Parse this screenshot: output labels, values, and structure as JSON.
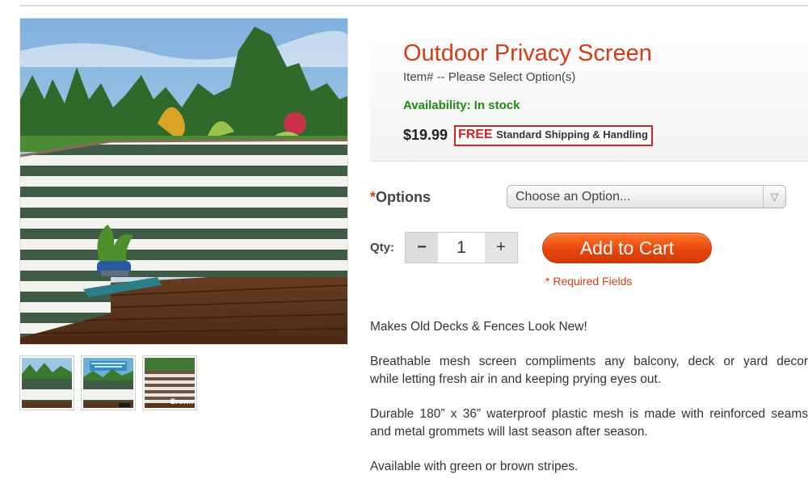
{
  "product": {
    "title": "Outdoor Privacy Screen",
    "item_number": "Item# -- Please Select Option(s)",
    "availability": "Availability: In stock",
    "price": "$19.99",
    "shipping_free": "FREE",
    "shipping_text": "Standard Shipping & Handling"
  },
  "options": {
    "required_mark": "*",
    "label": "Options",
    "select_value": "Choose an Option...",
    "arrow_glyph": "▽"
  },
  "quantity": {
    "label": "Qty:",
    "minus": "−",
    "value": "1",
    "plus": "+"
  },
  "cart": {
    "button_label": "Add to Cart",
    "required_note": "* Required Fields"
  },
  "description": {
    "line1": "Makes Old Decks & Fences Look New!",
    "para2_line1": "Breathable mesh screen compliments any balcony, deck or yard decor",
    "para2_line2": "while letting fresh air in and keeping prying eyes out.",
    "para3_line1": "Durable 180” x 36” waterproof plastic mesh is made with reinforced seams",
    "para3_line2": "and metal grommets will last season after season.",
    "line4": "Available with green or brown stripes."
  },
  "thumbnails": [
    {
      "label": ""
    },
    {
      "label": ""
    },
    {
      "label": "Brown"
    }
  ],
  "colors": {
    "title": "#d53b14",
    "availability": "#1f8a12",
    "shipping_border": "#d42222",
    "cart_button": "#e9460d",
    "stripe_green": "#3f5a45",
    "stripe_white": "#f2f2ef"
  }
}
